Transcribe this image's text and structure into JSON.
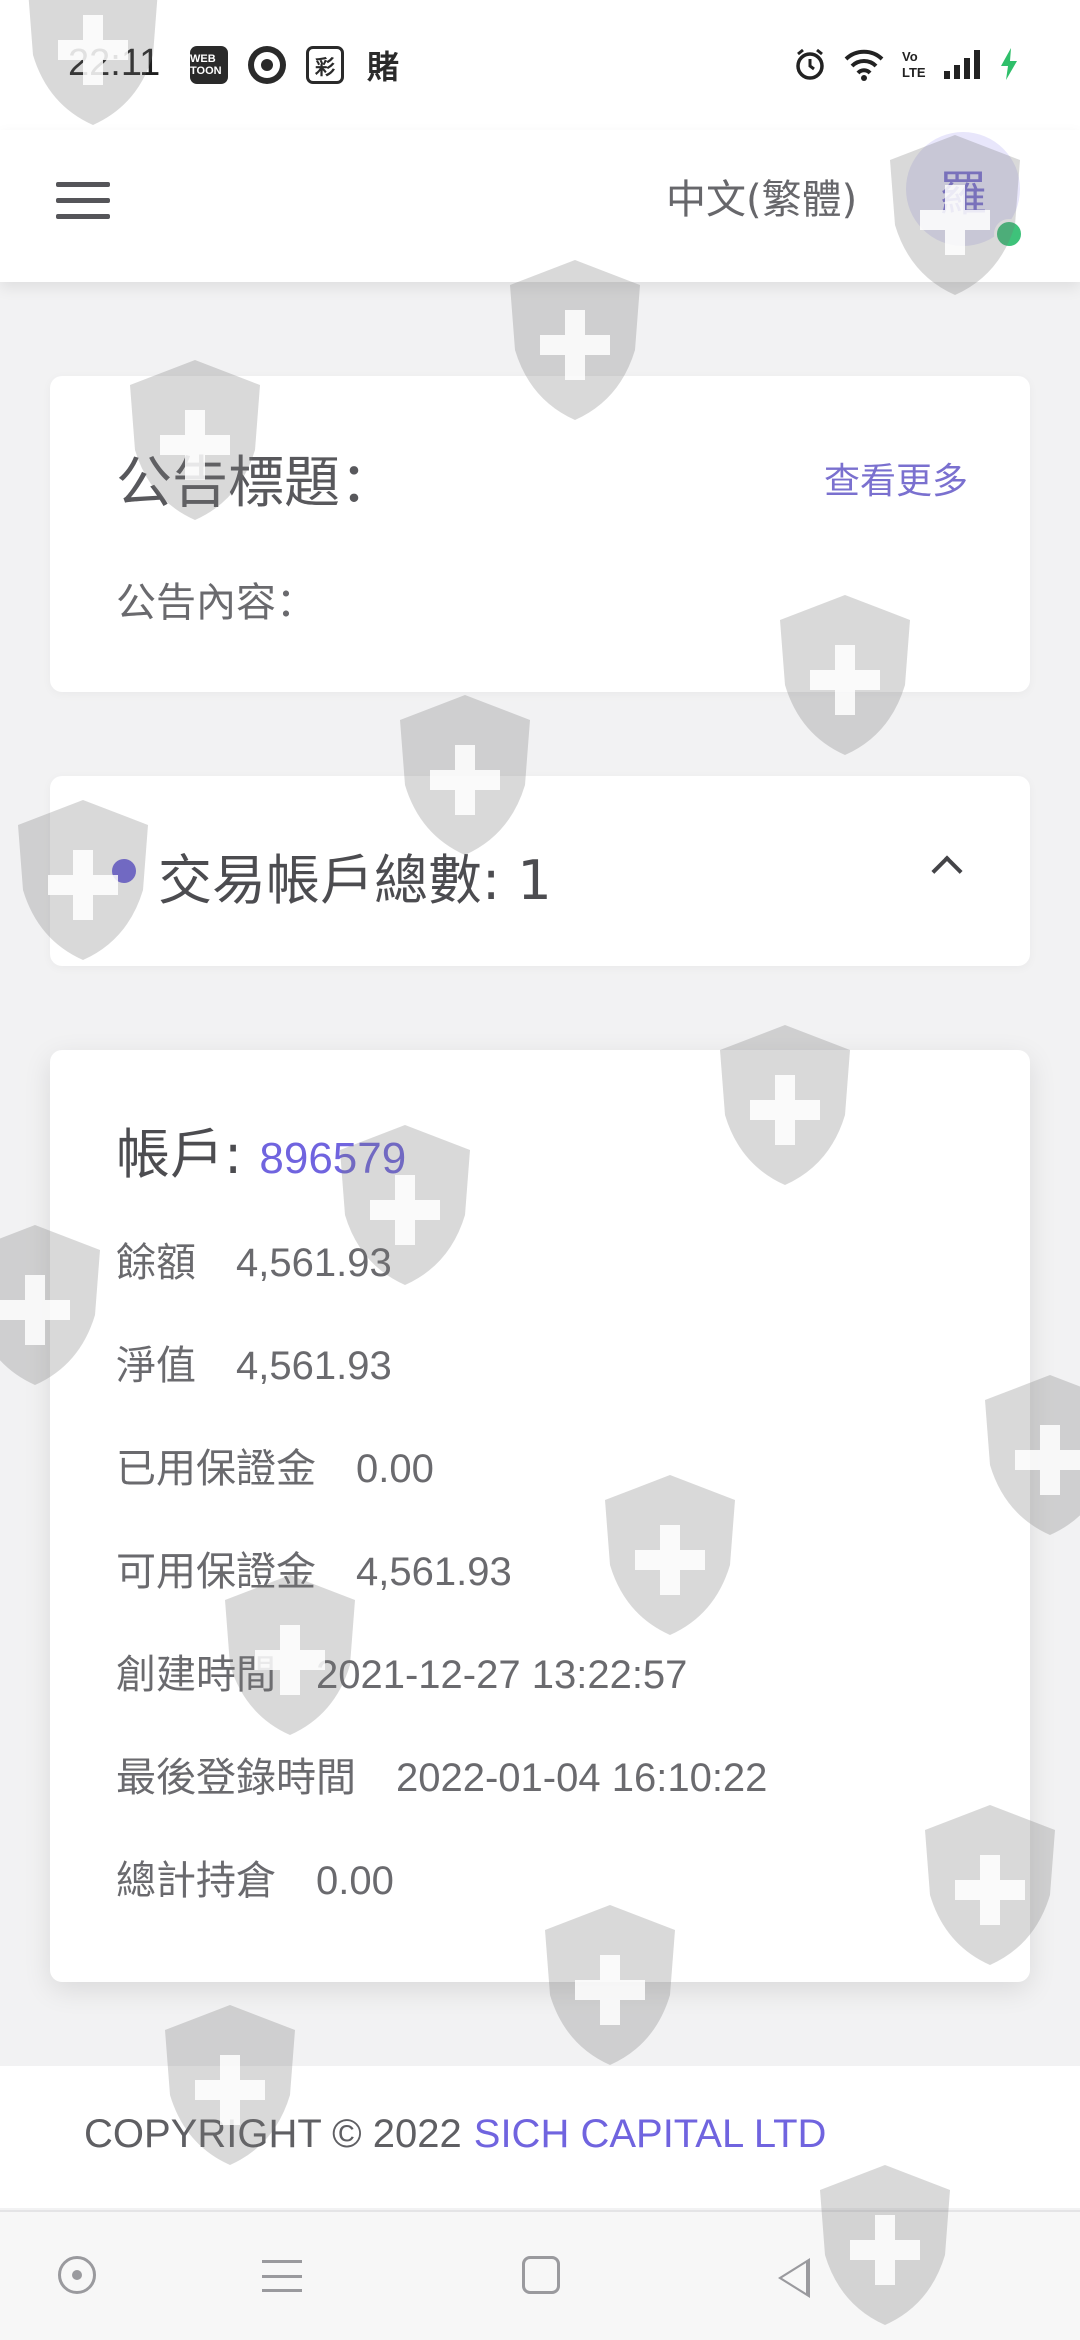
{
  "status_bar": {
    "time": "22:11",
    "app_icons": [
      "webtoon-icon",
      "chrome-icon",
      "lottery-icon",
      "bet-icon"
    ],
    "app_icon_labels": [
      "WEB TOON",
      "",
      "彩",
      "賭"
    ],
    "right_icons": [
      "alarm-icon",
      "wifi-icon",
      "volte-icon",
      "signal-icon",
      "charging-icon"
    ]
  },
  "header": {
    "language": "中文(繁體)",
    "avatar_initial": "羅",
    "avatar_status_color": "#3ec27a"
  },
  "notice": {
    "title": "公告標題：",
    "more_link": "查看更多",
    "content_label": "公告內容："
  },
  "accounts_summary": {
    "title": "交易帳戶總數: 1"
  },
  "account": {
    "label": "帳戶:",
    "id": "896579",
    "fields": [
      {
        "label": "餘額",
        "value": "4,561.93"
      },
      {
        "label": "淨值",
        "value": "4,561.93"
      },
      {
        "label": "已用保證金",
        "value": "0.00"
      },
      {
        "label": "可用保證金",
        "value": "4,561.93"
      },
      {
        "label": "創建時間",
        "value": "2021-12-27 13:22:57"
      },
      {
        "label": "最後登錄時間",
        "value": "2022-01-04 16:10:22"
      },
      {
        "label": "總計持倉",
        "value": "0.00"
      }
    ]
  },
  "footer": {
    "copyright": "COPYRIGHT © 2022",
    "company": "SICH CAPITAL LTD"
  },
  "nav_bar": {
    "icons": [
      "assistant-icon",
      "recent-apps-icon",
      "home-icon",
      "back-icon"
    ]
  },
  "colors": {
    "accent": "#7064df",
    "background": "#f2f2f3",
    "online": "#3ec27a"
  }
}
